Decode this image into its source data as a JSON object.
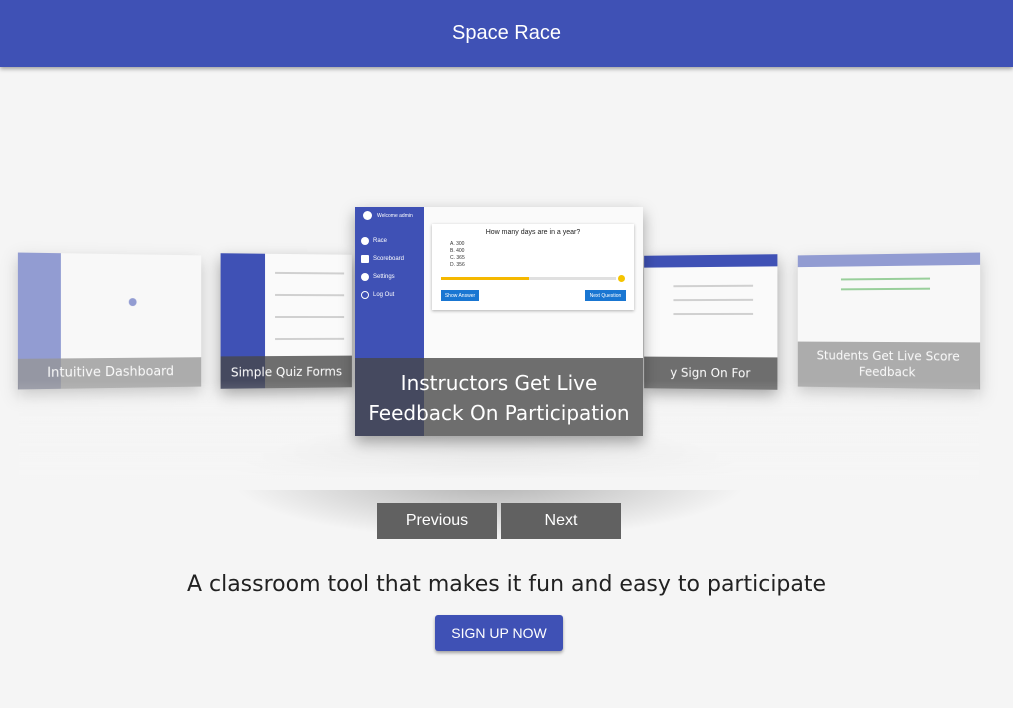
{
  "header": {
    "title": "Space Race"
  },
  "carousel": {
    "slides": [
      {
        "caption": "Intuitive Dashboard"
      },
      {
        "caption": "Simple Quiz Forms"
      },
      {
        "caption": "Instructors Get Live Feedback On Participation"
      },
      {
        "caption": "y Sign On For Students"
      },
      {
        "caption": "Students Get Live Score Feedback"
      }
    ],
    "center_slide": {
      "welcome": "Welcome admin",
      "nav": [
        "Race",
        "Scoreboard",
        "Settings",
        "Log Out"
      ],
      "question": "How many days are in a year?",
      "options": [
        "A. 300",
        "B. 400",
        "C. 365",
        "D. 356"
      ],
      "progress": 0.5,
      "show_answer_label": "Show Answer",
      "next_question_label": "Next Question"
    },
    "previous_label": "Previous",
    "next_label": "Next"
  },
  "tagline": "A classroom tool that makes it fun and easy to participate",
  "signup_label": "SIGN UP NOW",
  "colors": {
    "primary": "#3f51b5",
    "button_gray": "#616161",
    "accent_blue": "#1976d2",
    "progress_yellow": "#f5b800"
  }
}
